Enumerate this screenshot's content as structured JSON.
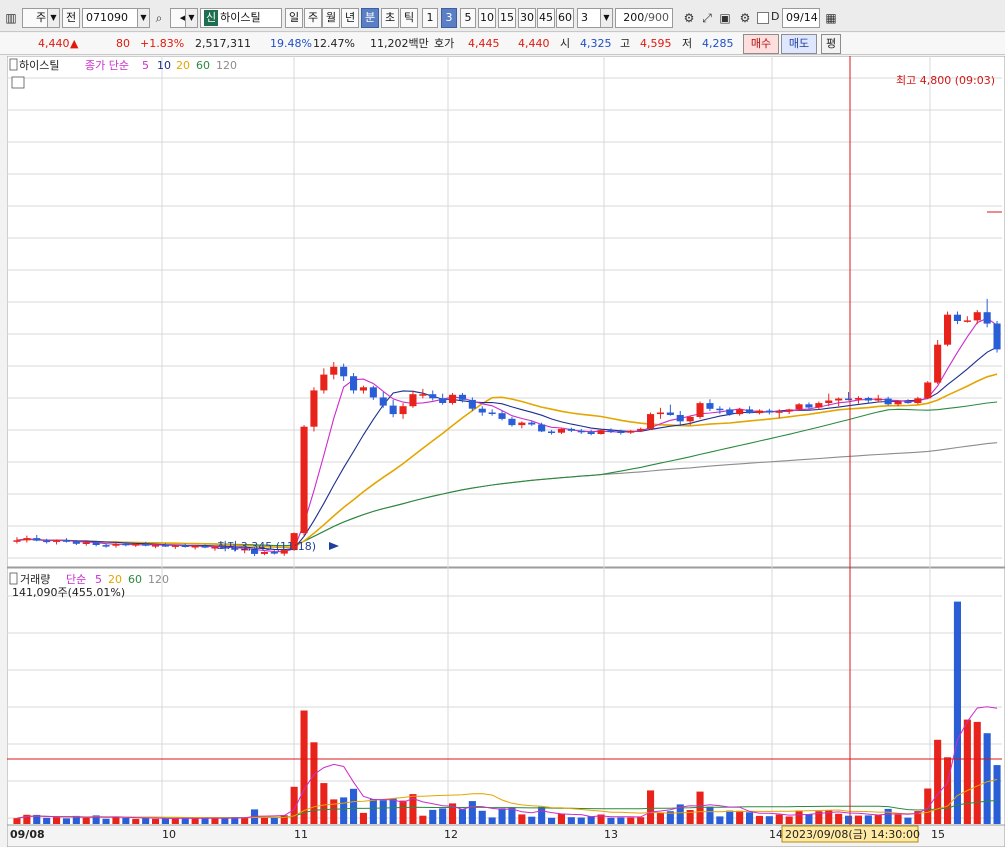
{
  "toolbar": {
    "period_select": "주",
    "all_label": "전",
    "code": "071090",
    "stock_tag": "신",
    "stock_name": "하이스틸",
    "period_buttons": [
      "일",
      "주",
      "월",
      "년",
      "분",
      "초",
      "틱"
    ],
    "active_period": "분",
    "intervals": [
      "1",
      "3",
      "5",
      "10",
      "15",
      "30",
      "45",
      "60"
    ],
    "active_interval": "3",
    "interval_value": "3",
    "count": "200",
    "count_total": "/900",
    "date_checkbox_label": "D",
    "date_value": "09/14"
  },
  "quote": {
    "price": "4,440",
    "arrow": "▲",
    "change": "80",
    "change_pct": "+1.83%",
    "volume": "2,517,311",
    "turnover_pct": "19.48%",
    "pct2": "12.47%",
    "amount": "11,202백만",
    "hoga_label": "호가",
    "ask": "4,445",
    "bid": "4,440",
    "open_label": "시",
    "open": "4,325",
    "high_label": "고",
    "high": "4,595",
    "low_label": "저",
    "low": "4,285",
    "buy_label": "매수",
    "sell_label": "매도",
    "flat_label": "평"
  },
  "colors": {
    "up": "#e8231b",
    "down": "#2a5ed6",
    "ma5": "#cc2ccc",
    "ma10": "#1c2f8c",
    "ma20": "#e3a600",
    "ma60": "#2b8a3e",
    "ma120": "#8c8c8c",
    "grid": "#d9d9d9",
    "crosshair": "#d81818"
  },
  "chart_data": {
    "type": "candlestick",
    "price_panel": {
      "legend_name": "하이스틸",
      "legend_indicator": "종가 단순",
      "ma_periods": [
        "5",
        "10",
        "20",
        "60",
        "120"
      ],
      "high_annotation": "최고 4,800 (09:03)",
      "low_annotation": "최저 3,345 (11:18)",
      "ohlc": [
        [
          3395,
          3405,
          3385,
          3395
        ],
        [
          3395,
          3410,
          3388,
          3402
        ],
        [
          3402,
          3412,
          3392,
          3394
        ],
        [
          3394,
          3400,
          3385,
          3390
        ],
        [
          3390,
          3398,
          3382,
          3395
        ],
        [
          3395,
          3402,
          3388,
          3392
        ],
        [
          3392,
          3396,
          3380,
          3384
        ],
        [
          3384,
          3392,
          3378,
          3388
        ],
        [
          3388,
          3394,
          3376,
          3380
        ],
        [
          3380,
          3386,
          3372,
          3378
        ],
        [
          3378,
          3388,
          3372,
          3384
        ],
        [
          3384,
          3390,
          3376,
          3380
        ],
        [
          3380,
          3386,
          3374,
          3383
        ],
        [
          3383,
          3390,
          3376,
          3378
        ],
        [
          3378,
          3384,
          3370,
          3380
        ],
        [
          3380,
          3386,
          3374,
          3376
        ],
        [
          3376,
          3382,
          3368,
          3379
        ],
        [
          3379,
          3385,
          3372,
          3374
        ],
        [
          3374,
          3380,
          3366,
          3377
        ],
        [
          3377,
          3382,
          3370,
          3372
        ],
        [
          3372,
          3378,
          3362,
          3374
        ],
        [
          3374,
          3380,
          3368,
          3370
        ],
        [
          3370,
          3376,
          3360,
          3365
        ],
        [
          3365,
          3372,
          3354,
          3368
        ],
        [
          3368,
          3374,
          3345,
          3352
        ],
        [
          3352,
          3360,
          3348,
          3358
        ],
        [
          3358,
          3364,
          3350,
          3353
        ],
        [
          3353,
          3360,
          3346,
          3364
        ],
        [
          3364,
          3420,
          3362,
          3418
        ],
        [
          3418,
          3760,
          3410,
          3755
        ],
        [
          3755,
          3880,
          3740,
          3870
        ],
        [
          3870,
          3940,
          3860,
          3920
        ],
        [
          3920,
          3960,
          3905,
          3945
        ],
        [
          3945,
          3955,
          3900,
          3915
        ],
        [
          3915,
          3925,
          3860,
          3870
        ],
        [
          3870,
          3885,
          3860,
          3880
        ],
        [
          3880,
          3885,
          3840,
          3848
        ],
        [
          3848,
          3865,
          3815,
          3822
        ],
        [
          3822,
          3840,
          3785,
          3795
        ],
        [
          3795,
          3830,
          3780,
          3820
        ],
        [
          3820,
          3870,
          3815,
          3858
        ],
        [
          3858,
          3875,
          3845,
          3858
        ],
        [
          3858,
          3870,
          3838,
          3845
        ],
        [
          3845,
          3860,
          3825,
          3830
        ],
        [
          3830,
          3862,
          3825,
          3856
        ],
        [
          3856,
          3862,
          3832,
          3840
        ],
        [
          3840,
          3848,
          3805,
          3812
        ],
        [
          3812,
          3820,
          3790,
          3800
        ],
        [
          3800,
          3810,
          3790,
          3798
        ],
        [
          3798,
          3805,
          3775,
          3780
        ],
        [
          3780,
          3786,
          3755,
          3760
        ],
        [
          3760,
          3772,
          3750,
          3768
        ],
        [
          3768,
          3774,
          3758,
          3762
        ],
        [
          3762,
          3768,
          3738,
          3740
        ],
        [
          3740,
          3745,
          3730,
          3736
        ],
        [
          3736,
          3750,
          3732,
          3748
        ],
        [
          3748,
          3752,
          3738,
          3742
        ],
        [
          3742,
          3748,
          3732,
          3738
        ],
        [
          3738,
          3745,
          3728,
          3732
        ],
        [
          3732,
          3745,
          3730,
          3744
        ],
        [
          3744,
          3750,
          3735,
          3740
        ],
        [
          3740,
          3746,
          3730,
          3736
        ],
        [
          3736,
          3745,
          3732,
          3742
        ],
        [
          3742,
          3752,
          3738,
          3748
        ],
        [
          3748,
          3800,
          3745,
          3795
        ],
        [
          3795,
          3815,
          3780,
          3800
        ],
        [
          3800,
          3825,
          3790,
          3792
        ],
        [
          3792,
          3805,
          3762,
          3772
        ],
        [
          3772,
          3790,
          3760,
          3786
        ],
        [
          3786,
          3835,
          3780,
          3830
        ],
        [
          3830,
          3842,
          3805,
          3812
        ],
        [
          3812,
          3820,
          3796,
          3810
        ],
        [
          3810,
          3816,
          3790,
          3795
        ],
        [
          3795,
          3815,
          3790,
          3810
        ],
        [
          3810,
          3820,
          3796,
          3798
        ],
        [
          3798,
          3810,
          3794,
          3806
        ],
        [
          3806,
          3812,
          3794,
          3800
        ],
        [
          3800,
          3810,
          3782,
          3804
        ],
        [
          3804,
          3812,
          3795,
          3810
        ],
        [
          3810,
          3830,
          3805,
          3826
        ],
        [
          3826,
          3832,
          3812,
          3816
        ],
        [
          3816,
          3835,
          3810,
          3830
        ],
        [
          3830,
          3860,
          3820,
          3838
        ],
        [
          3838,
          3848,
          3820,
          3844
        ],
        [
          3844,
          3865,
          3838,
          3842
        ],
        [
          3842,
          3852,
          3828,
          3846
        ],
        [
          3846,
          3850,
          3832,
          3838
        ],
        [
          3838,
          3856,
          3832,
          3844
        ],
        [
          3844,
          3850,
          3822,
          3826
        ],
        [
          3826,
          3840,
          3820,
          3835
        ],
        [
          3835,
          3842,
          3828,
          3830
        ],
        [
          3830,
          3850,
          3826,
          3845
        ],
        [
          3845,
          3900,
          3842,
          3895
        ],
        [
          3895,
          4030,
          3890,
          4015
        ],
        [
          4015,
          4120,
          4010,
          4110
        ],
        [
          4110,
          4120,
          4080,
          4090
        ],
        [
          4090,
          4105,
          4085,
          4092
        ],
        [
          4092,
          4125,
          4080,
          4118
        ],
        [
          4118,
          4160,
          4070,
          4082
        ],
        [
          4082,
          4090,
          3990,
          4000
        ]
      ]
    },
    "volume_panel": {
      "legend_name": "거래량",
      "legend_indicator": "단순",
      "ma_periods": [
        "5",
        "20",
        "60",
        "120"
      ],
      "current_value": "141,090주(455.01%)"
    },
    "x_labels": [
      "09/08",
      "10",
      "11",
      "12",
      "13",
      "14",
      "15"
    ],
    "crosshair_label": "2023/09/08(금) 14:30:00"
  }
}
